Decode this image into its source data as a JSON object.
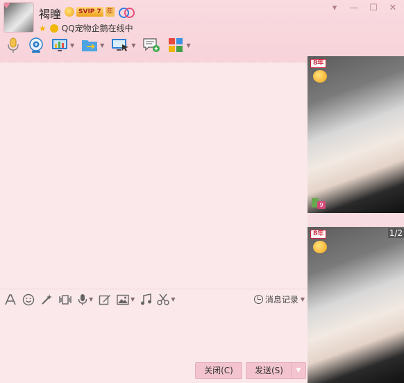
{
  "header": {
    "nickname": "褐瞳",
    "vip_label": "SVIP 7",
    "year_label": "年",
    "status_text": "QQ宠物企鹅在线中"
  },
  "window_controls": {
    "dropdown": "▾",
    "minimize": "—",
    "maximize": "☐",
    "close": "✕"
  },
  "toolbar": {
    "tools": [
      {
        "name": "voice-call-icon"
      },
      {
        "name": "video-call-icon"
      },
      {
        "name": "remote-desktop-icon",
        "has_menu": true
      },
      {
        "name": "send-file-icon",
        "has_menu": true
      },
      {
        "name": "screen-share-icon",
        "has_menu": true
      },
      {
        "name": "create-discussion-icon"
      },
      {
        "name": "apps-icon",
        "has_menu": true
      }
    ]
  },
  "edit_toolbar": {
    "history_label": "消息记录"
  },
  "buttons": {
    "close_label": "关闭(C)",
    "send_label": "发送(S)"
  },
  "right_panel": {
    "photo_badge": "8年",
    "small_badge": "9",
    "page_indicator": "1/2"
  },
  "colors": {
    "theme_pink": "#fbe8ea",
    "titlebar_pink": "#f7d3da",
    "button_pink": "#f3c4cf"
  }
}
